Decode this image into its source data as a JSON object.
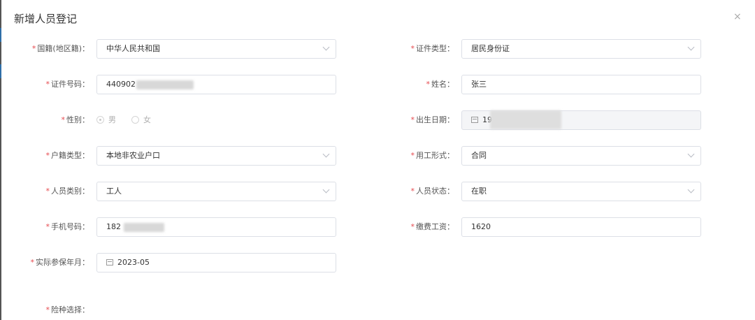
{
  "dialog": {
    "title": "新增人员登记",
    "close_glyph": "×"
  },
  "required_mark": "*",
  "fields": {
    "nationality": {
      "label": "国籍(地区籍)：",
      "value": "中华人民共和国"
    },
    "id_type": {
      "label": "证件类型：",
      "value": "居民身份证"
    },
    "id_number": {
      "label": "证件号码：",
      "value": "440902"
    },
    "name": {
      "label": "姓名：",
      "value": "张三"
    },
    "gender": {
      "label": "性别：",
      "options": [
        "男",
        "女"
      ],
      "selected": "男"
    },
    "birth_date": {
      "label": "出生日期：",
      "value": "19"
    },
    "household_type": {
      "label": "户籍类型：",
      "value": "本地非农业户口"
    },
    "employment_form": {
      "label": "用工形式：",
      "value": "合同"
    },
    "person_category": {
      "label": "人员类别：",
      "value": "工人"
    },
    "person_status": {
      "label": "人员状态：",
      "value": "在职"
    },
    "phone": {
      "label": "手机号码：",
      "value": "182"
    },
    "contribution_wage": {
      "label": "缴费工资：",
      "value": "1620"
    },
    "insured_month": {
      "label": "实际参保年月：",
      "value": "2023-05"
    },
    "insurance_types": {
      "label": "险种选择："
    }
  },
  "icons": {
    "select": "chevron-down-icon",
    "date": "calendar-icon",
    "close": "close-icon"
  },
  "colors": {
    "required": "#e6494e",
    "border": "#dcdfe6",
    "disabled_bg": "#f4f5f7"
  }
}
